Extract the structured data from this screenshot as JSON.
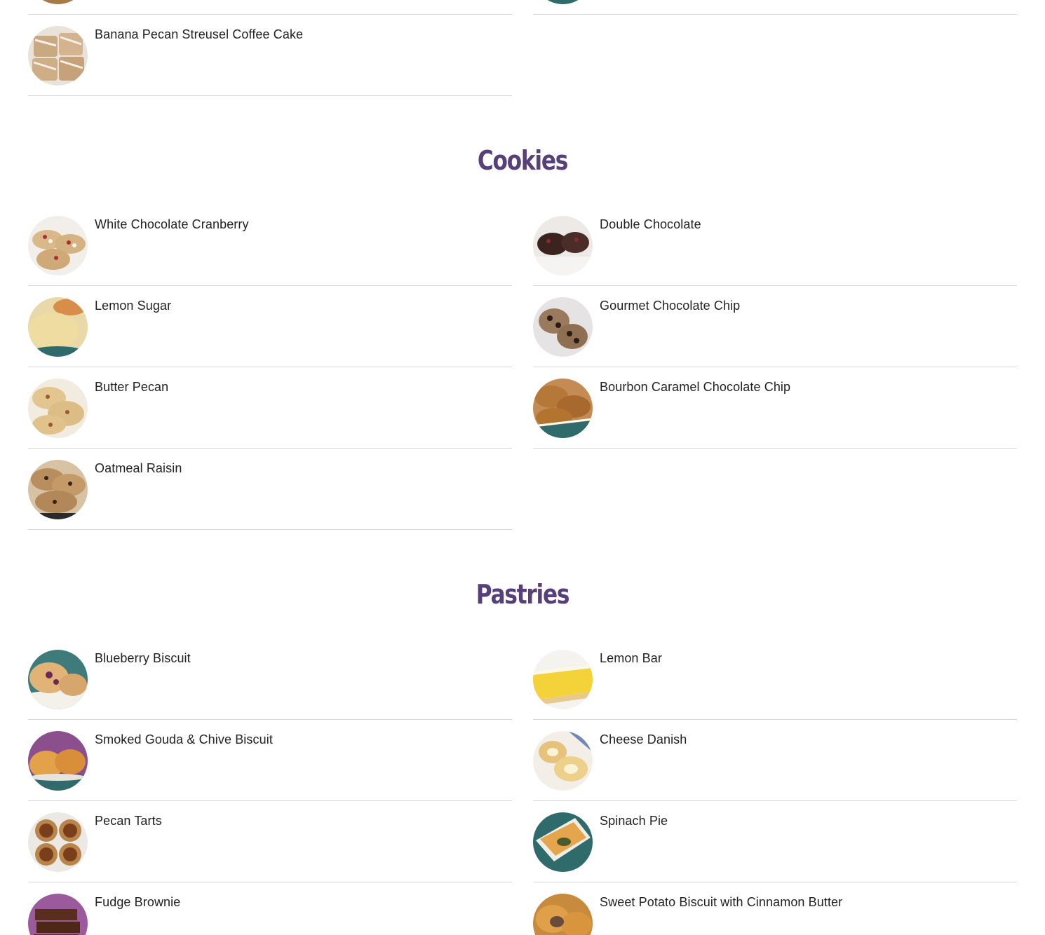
{
  "top_section": {
    "items": [
      {
        "title": "Banana Pecan Streusel Coffee Cake",
        "thumb": "banana-pecan-coffee-cake"
      }
    ]
  },
  "cookies": {
    "heading": "Cookies",
    "items": [
      {
        "title": "White Chocolate Cranberry",
        "thumb": "white-chocolate-cranberry"
      },
      {
        "title": "Double Chocolate",
        "thumb": "double-chocolate"
      },
      {
        "title": "Lemon Sugar",
        "thumb": "lemon-sugar"
      },
      {
        "title": "Gourmet Chocolate Chip",
        "thumb": "gourmet-chocolate-chip"
      },
      {
        "title": "Butter Pecan",
        "thumb": "butter-pecan"
      },
      {
        "title": "Bourbon Caramel Chocolate Chip",
        "thumb": "bourbon-caramel-chocolate-chip"
      },
      {
        "title": "Oatmeal Raisin",
        "thumb": "oatmeal-raisin"
      }
    ]
  },
  "pastries": {
    "heading": "Pastries",
    "items": [
      {
        "title": "Blueberry Biscuit",
        "thumb": "blueberry-biscuit"
      },
      {
        "title": "Lemon Bar",
        "thumb": "lemon-bar"
      },
      {
        "title": "Smoked Gouda & Chive Biscuit",
        "thumb": "smoked-gouda-biscuit"
      },
      {
        "title": "Cheese Danish",
        "thumb": "cheese-danish"
      },
      {
        "title": "Pecan Tarts",
        "thumb": "pecan-tarts"
      },
      {
        "title": "Spinach Pie",
        "thumb": "spinach-pie"
      },
      {
        "title": "Fudge Brownie",
        "thumb": "fudge-brownie"
      },
      {
        "title": "Sweet Potato Biscuit with Cinnamon Butter",
        "thumb": "sweet-potato-biscuit"
      }
    ]
  },
  "colors": {
    "heading": "#55407a",
    "divider": "#d6d6d6",
    "text": "#222222",
    "teal_plate": "#2f6b6b"
  }
}
